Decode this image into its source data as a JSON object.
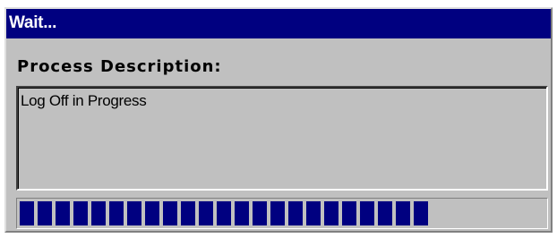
{
  "window": {
    "title": "Wait..."
  },
  "process": {
    "label": "Process Description:",
    "description": "Log Off in Progress"
  },
  "progress": {
    "fraction": 0.81,
    "color": "#000080"
  },
  "colors": {
    "titlebar": "#000080",
    "title_text": "#ffffff",
    "dialog_face": "#c0c0c0"
  }
}
